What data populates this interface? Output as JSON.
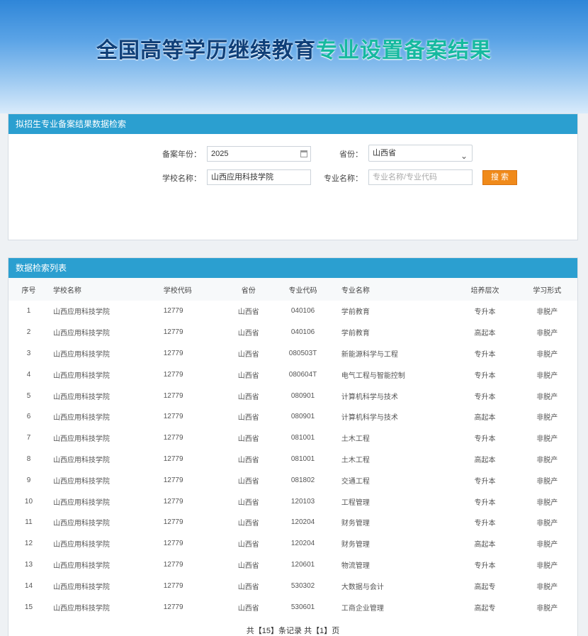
{
  "title": {
    "part1": "全国高等学历继续教育",
    "part2": "专业设置备案结果"
  },
  "search": {
    "header": "拟招生专业备案结果数据检索",
    "year_label": "备案年份：",
    "year_value": "2025",
    "province_label": "省份：",
    "province_value": "山西省",
    "school_label": "学校名称：",
    "school_value": "山西应用科技学院",
    "major_label": "专业名称：",
    "major_placeholder": "专业名称/专业代码",
    "search_button": "搜 索"
  },
  "list": {
    "header": "数据检索列表",
    "columns": [
      "序号",
      "学校名称",
      "学校代码",
      "省份",
      "专业代码",
      "专业名称",
      "培养层次",
      "学习形式"
    ],
    "rows": [
      [
        "1",
        "山西应用科技学院",
        "12779",
        "山西省",
        "040106",
        "学前教育",
        "专升本",
        "非脱产"
      ],
      [
        "2",
        "山西应用科技学院",
        "12779",
        "山西省",
        "040106",
        "学前教育",
        "高起本",
        "非脱产"
      ],
      [
        "3",
        "山西应用科技学院",
        "12779",
        "山西省",
        "080503T",
        "新能源科学与工程",
        "专升本",
        "非脱产"
      ],
      [
        "4",
        "山西应用科技学院",
        "12779",
        "山西省",
        "080604T",
        "电气工程与智能控制",
        "专升本",
        "非脱产"
      ],
      [
        "5",
        "山西应用科技学院",
        "12779",
        "山西省",
        "080901",
        "计算机科学与技术",
        "专升本",
        "非脱产"
      ],
      [
        "6",
        "山西应用科技学院",
        "12779",
        "山西省",
        "080901",
        "计算机科学与技术",
        "高起本",
        "非脱产"
      ],
      [
        "7",
        "山西应用科技学院",
        "12779",
        "山西省",
        "081001",
        "土木工程",
        "专升本",
        "非脱产"
      ],
      [
        "8",
        "山西应用科技学院",
        "12779",
        "山西省",
        "081001",
        "土木工程",
        "高起本",
        "非脱产"
      ],
      [
        "9",
        "山西应用科技学院",
        "12779",
        "山西省",
        "081802",
        "交通工程",
        "专升本",
        "非脱产"
      ],
      [
        "10",
        "山西应用科技学院",
        "12779",
        "山西省",
        "120103",
        "工程管理",
        "专升本",
        "非脱产"
      ],
      [
        "11",
        "山西应用科技学院",
        "12779",
        "山西省",
        "120204",
        "财务管理",
        "专升本",
        "非脱产"
      ],
      [
        "12",
        "山西应用科技学院",
        "12779",
        "山西省",
        "120204",
        "财务管理",
        "高起本",
        "非脱产"
      ],
      [
        "13",
        "山西应用科技学院",
        "12779",
        "山西省",
        "120601",
        "物流管理",
        "专升本",
        "非脱产"
      ],
      [
        "14",
        "山西应用科技学院",
        "12779",
        "山西省",
        "530302",
        "大数据与会计",
        "高起专",
        "非脱产"
      ],
      [
        "15",
        "山西应用科技学院",
        "12779",
        "山西省",
        "530601",
        "工商企业管理",
        "高起专",
        "非脱产"
      ]
    ],
    "pager": "共【15】条记录 共【1】页"
  },
  "colors": {
    "header_blue": "#2b9fd0",
    "button_orange": "#f08a1a",
    "title_dark": "#0f3f78",
    "title_teal": "#16b99f"
  },
  "icons": {
    "year_field": "calendar-icon",
    "province_select": "chevron-down-icon"
  }
}
